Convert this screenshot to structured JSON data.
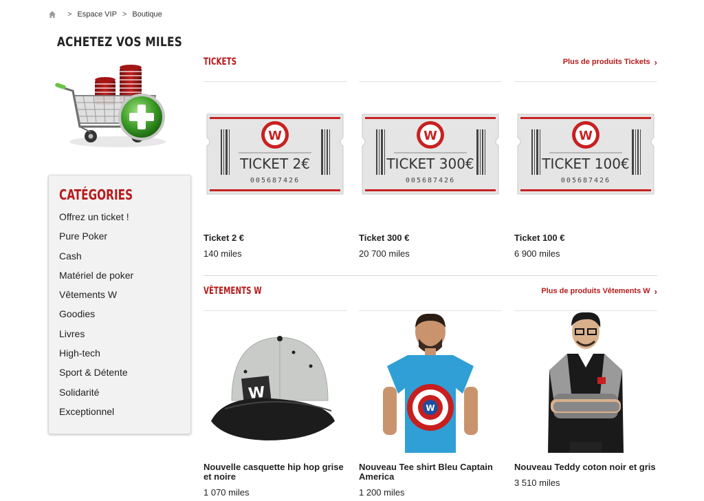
{
  "breadcrumb": {
    "items": [
      "Espace VIP",
      "Boutique"
    ],
    "sep": ">"
  },
  "left": {
    "buy_title": "ACHETEZ VOS MILES",
    "categories_title": "CATÉGORIES",
    "categories": [
      "Offrez un ticket !",
      "Pure Poker",
      "Cash",
      "Matériel de poker",
      "Vêtements W",
      "Goodies",
      "Livres",
      "High-tech",
      "Sport & Détente",
      "Solidarité",
      "Exceptionnel"
    ]
  },
  "sections": {
    "tickets": {
      "title": "TICKETS",
      "more": "Plus de produits Tickets",
      "products": [
        {
          "name": "Ticket 2 €",
          "price": "140 miles",
          "ticket_label": "TICKET 2€",
          "serial": "005687426"
        },
        {
          "name": "Ticket 300 €",
          "price": "20 700 miles",
          "ticket_label": "TICKET 300€",
          "serial": "005687426"
        },
        {
          "name": "Ticket 100 €",
          "price": "6 900 miles",
          "ticket_label": "TICKET 100€",
          "serial": "005687426"
        }
      ]
    },
    "clothes": {
      "title": "VÊTEMENTS W",
      "more": "Plus de produits Vêtements W",
      "products": [
        {
          "name": "Nouvelle casquette hip hop grise et noire",
          "price": "1 070 miles"
        },
        {
          "name": "Nouveau Tee shirt Bleu Captain America",
          "price": "1 200 miles"
        },
        {
          "name": "Nouveau Teddy coton noir et gris",
          "price": "3 510 miles"
        }
      ]
    }
  },
  "colors": {
    "accent": "#b51b1b",
    "category_bg": "#f2f2f2",
    "text": "#222222"
  },
  "icons": {
    "home": "home-icon",
    "chevron": "chevron-right-icon",
    "cart": "shopping-cart-plus-icon"
  }
}
